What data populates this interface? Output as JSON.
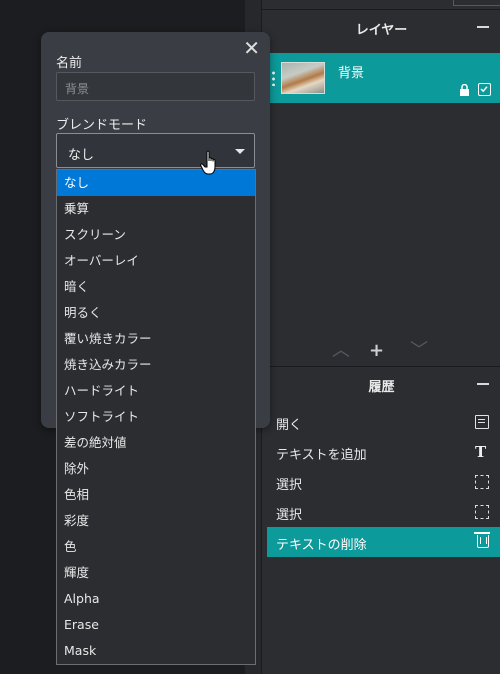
{
  "right": {
    "layers": {
      "title": "レイヤー",
      "item": {
        "name": "背景"
      }
    },
    "history": {
      "title": "履歴",
      "items": [
        {
          "label": "開く",
          "icon": "document-icon"
        },
        {
          "label": "テキストを追加",
          "icon": "text-tool-icon"
        },
        {
          "label": "選択",
          "icon": "selection-icon"
        },
        {
          "label": "選択",
          "icon": "selection-icon"
        },
        {
          "label": "テキストの削除",
          "icon": "trash-icon",
          "active": true
        }
      ]
    }
  },
  "dialog": {
    "name_label": "名前",
    "name_placeholder": "背景",
    "blend_label": "ブレンドモード",
    "blend_value": "なし",
    "options": [
      "なし",
      "乗算",
      "スクリーン",
      "オーバーレイ",
      "暗く",
      "明るく",
      "覆い焼きカラー",
      "焼き込みカラー",
      "ハードライト",
      "ソフトライト",
      "差の絶対値",
      "除外",
      "色相",
      "彩度",
      "色",
      "輝度",
      "Alpha",
      "Erase",
      "Mask"
    ],
    "selected_index": 0
  },
  "colors": {
    "accent_teal": "#0d9a9a",
    "selection_blue": "#0078d7",
    "panel_bg": "#2b2d31",
    "dialog_bg": "#3a3d43"
  }
}
